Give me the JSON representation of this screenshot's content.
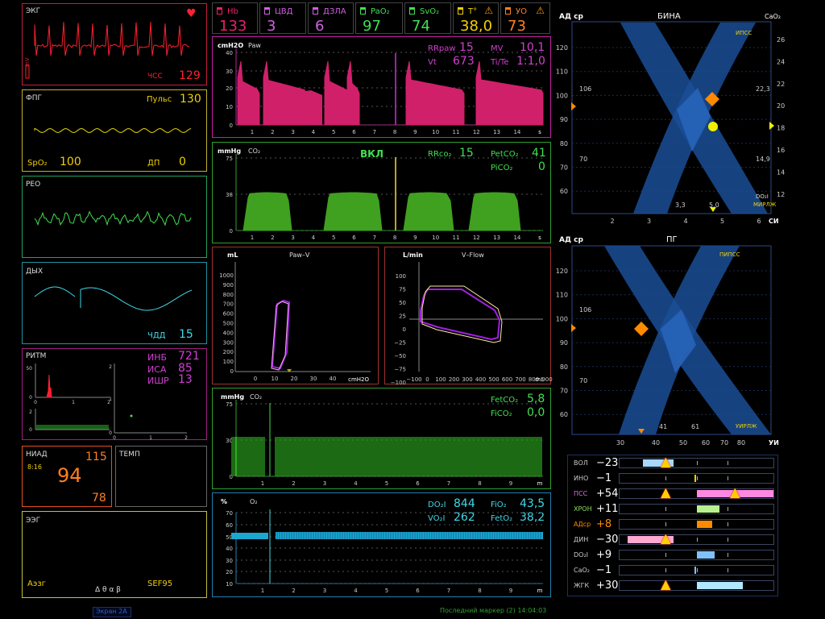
{
  "left": {
    "ecg": {
      "title": "ЭКГ",
      "hr_label": "ЧСС",
      "hr_value": "129",
      "scale": "mV"
    },
    "ppg": {
      "title": "ФПГ",
      "pulse_label": "Пульс",
      "pulse_value": "130",
      "spo2_label": "SpO₂",
      "spo2_value": "100",
      "dp_label": "ДП",
      "dp_value": "0"
    },
    "reo": {
      "title": "РЕО"
    },
    "resp": {
      "title": "ДЫХ",
      "rr_label": "ЧДД",
      "rr_value": "15"
    },
    "rhythm": {
      "title": "РИТМ",
      "inb_label": "ИНБ",
      "inb_value": "721",
      "isa_label": "ИСА",
      "isa_value": "85",
      "ishr_label": "ИШР",
      "ishr_value": "13",
      "hist_y_ticks": [
        "50",
        "0"
      ],
      "hist_x_ticks": [
        "0",
        "1",
        "2"
      ],
      "strip_y_ticks": [
        "2",
        "0"
      ],
      "scatter_y_ticks": [
        "2",
        "1",
        "0"
      ],
      "scatter_x_ticks": [
        "0",
        "1",
        "2"
      ]
    },
    "niad": {
      "title": "НИАД",
      "time": "8:16",
      "sys": "115",
      "mean": "94",
      "dia": "78"
    },
    "temp": {
      "title": "ТЕМП"
    },
    "eeg": {
      "title": "ЭЭГ",
      "aeeg_label": "Аэзг",
      "bands": "Δ θ α β",
      "sef_label": "SEF95"
    },
    "screen_label": "Экран 2А"
  },
  "tiles": [
    {
      "name": "Hb",
      "value": "133",
      "color": "#e8206a"
    },
    {
      "name": "ЦВД",
      "value": "3",
      "color": "#d060e0"
    },
    {
      "name": "ДЗЛА",
      "value": "6",
      "color": "#d060e0"
    },
    {
      "name": "PaO₂",
      "value": "97",
      "color": "#40e050"
    },
    {
      "name": "SvO₂",
      "value": "74",
      "color": "#40e050"
    },
    {
      "name": "T°",
      "value": "38,0",
      "color": "#f0d000"
    },
    {
      "name": "УО",
      "value": "73",
      "color": "#ff8020"
    }
  ],
  "paw": {
    "unit": "cmH2O",
    "title": "Paw",
    "y_ticks": [
      "40",
      "30",
      "20",
      "10",
      "0"
    ],
    "x_ticks": [
      "1",
      "2",
      "3",
      "4",
      "5",
      "6",
      "7",
      "8",
      "9",
      "10",
      "11",
      "12",
      "13",
      "14",
      "s"
    ],
    "rrpaw_label": "RRpaw",
    "rrpaw_value": "15",
    "mv_label": "MV",
    "mv_value": "10,1",
    "vt_label": "Vt",
    "vt_value": "673",
    "tite_label": "Ti/Te",
    "tite_value": "1:1,0"
  },
  "co2": {
    "unit": "mmHg",
    "title": "CO₂",
    "status": "ВКЛ",
    "y_ticks": [
      "75",
      "38",
      "0"
    ],
    "x_ticks": [
      "1",
      "2",
      "3",
      "4",
      "5",
      "6",
      "7",
      "8",
      "9",
      "10",
      "11",
      "12",
      "13",
      "14",
      "s"
    ],
    "rr_label": "RRco₂",
    "rr_value": "15",
    "petco2_label": "PetCO₂",
    "petco2_value": "41",
    "pico2_label": "PiCO₂",
    "pico2_value": "0"
  },
  "loop_paw": {
    "unit": "mL",
    "title": "Paw–V",
    "x_unit": "cmH2O",
    "y_ticks": [
      "1000",
      "900",
      "800",
      "700",
      "600",
      "500",
      "400",
      "300",
      "200",
      "100",
      "0"
    ],
    "x_ticks": [
      "0",
      "10",
      "20",
      "30",
      "40",
      "50"
    ]
  },
  "loop_flow": {
    "unit": "L/min",
    "title": "V–Flow",
    "x_unit": "mL",
    "y_ticks": [
      "100",
      "75",
      "50",
      "25",
      "0",
      "−25",
      "−50",
      "−75",
      "−100"
    ],
    "x_ticks": [
      "−100",
      "0",
      "100",
      "200",
      "300",
      "400",
      "500",
      "600",
      "700",
      "800",
      "900"
    ]
  },
  "co2trend": {
    "unit": "mmHg",
    "title": "CO₂",
    "y_ticks": [
      "75",
      "30",
      "0"
    ],
    "x_ticks": [
      "1",
      "2",
      "3",
      "4",
      "5",
      "6",
      "7",
      "8",
      "9",
      "m"
    ],
    "fetco2_label": "FetCO₂",
    "fetco2_value": "5,8",
    "fico2_label": "FiCO₂",
    "fico2_value": "0,0"
  },
  "o2trend": {
    "unit": "%",
    "title": "O₂",
    "y_ticks": [
      "70",
      "60",
      "50",
      "40",
      "30",
      "20",
      "10"
    ],
    "x_ticks": [
      "1",
      "2",
      "3",
      "4",
      "5",
      "6",
      "7",
      "8",
      "9",
      "m"
    ],
    "do2_label": "DO₂I",
    "do2_value": "844",
    "vo2_label": "VO₂I",
    "vo2_value": "262",
    "fio2_label": "FiO₂",
    "fio2_value": "43,5",
    "feto2_label": "FetO₂",
    "feto2_value": "38,2"
  },
  "bina": {
    "title": "БИНА",
    "y_label": "АД ср",
    "right_label": "CaO₂",
    "x_label": "СИ",
    "top_band": "ИПСС",
    "bottom_band": "МИРЛЖ",
    "do2_tag": "DO₂I",
    "y_ticks": [
      "120",
      "110",
      "100",
      "90",
      "80",
      "70",
      "60"
    ],
    "right_ticks": [
      "26",
      "24",
      "22",
      "20",
      "18",
      "16",
      "14",
      "12"
    ],
    "x_ticks": [
      "2",
      "3",
      "4",
      "5",
      "6"
    ],
    "ann_106": "106",
    "ann_70": "70",
    "ann_223": "22,3",
    "ann_149": "14,9",
    "ann_33": "3,3",
    "ann_50": "5,0"
  },
  "pg": {
    "title": "ПГ",
    "y_label": "АД ср",
    "x_label": "УИ",
    "top_band": "ПИПСС",
    "bottom_band": "УИРЛЖ",
    "y_ticks": [
      "120",
      "110",
      "100",
      "90",
      "80",
      "70",
      "60"
    ],
    "x_ticks": [
      "30",
      "40",
      "50",
      "60",
      "70",
      "80"
    ],
    "ann_106": "106",
    "ann_70": "70",
    "ann_41": "41",
    "ann_61": "61"
  },
  "metrics": [
    {
      "name": "ВОЛ",
      "value": "−23",
      "color": "#a8d8ff",
      "nameColor": "#cccccc",
      "valColor": "#ffffff",
      "bar_from": 0.15,
      "bar_to": 0.35,
      "warn": [
        0.3
      ]
    },
    {
      "name": "ИНО",
      "value": "−1",
      "color": "#f0d000",
      "nameColor": "#cccccc",
      "valColor": "#ffffff",
      "bar_from": 0.485,
      "bar_to": 0.5,
      "warn": []
    },
    {
      "name": "ПСС",
      "value": "+54",
      "color": "#ff88e0",
      "nameColor": "#e070e0",
      "valColor": "#ffffff",
      "bar_from": 0.5,
      "bar_to": 1.0,
      "warn": [
        0.3,
        0.75
      ]
    },
    {
      "name": "ХРОН",
      "value": "+11",
      "color": "#b8f090",
      "nameColor": "#8ce060",
      "valColor": "#ffffff",
      "bar_from": 0.5,
      "bar_to": 0.65,
      "warn": []
    },
    {
      "name": "АДср",
      "value": "+8",
      "color": "#ff8a00",
      "nameColor": "#ff8a00",
      "valColor": "#ff8a00",
      "bar_from": 0.5,
      "bar_to": 0.6,
      "warn": []
    },
    {
      "name": "ДИН",
      "value": "−30",
      "color": "#ffa8d0",
      "nameColor": "#cccccc",
      "valColor": "#ffffff",
      "bar_from": 0.05,
      "bar_to": 0.35,
      "warn": [
        0.3
      ]
    },
    {
      "name": "DO₂I",
      "value": "+9",
      "color": "#80c0ff",
      "nameColor": "#cccccc",
      "valColor": "#ffffff",
      "bar_from": 0.5,
      "bar_to": 0.62,
      "warn": []
    },
    {
      "name": "CaO₂",
      "value": "−1",
      "color": "#80c0ff",
      "nameColor": "#cccccc",
      "valColor": "#ffffff",
      "bar_from": 0.485,
      "bar_to": 0.5,
      "warn": []
    },
    {
      "name": "ЖГК",
      "value": "+30",
      "color": "#b0e8ff",
      "nameColor": "#cccccc",
      "valColor": "#ffffff",
      "bar_from": 0.5,
      "bar_to": 0.8,
      "warn": [
        0.3
      ]
    }
  ],
  "footer": {
    "marker": "Последний маркер (2) 14:04:03"
  }
}
